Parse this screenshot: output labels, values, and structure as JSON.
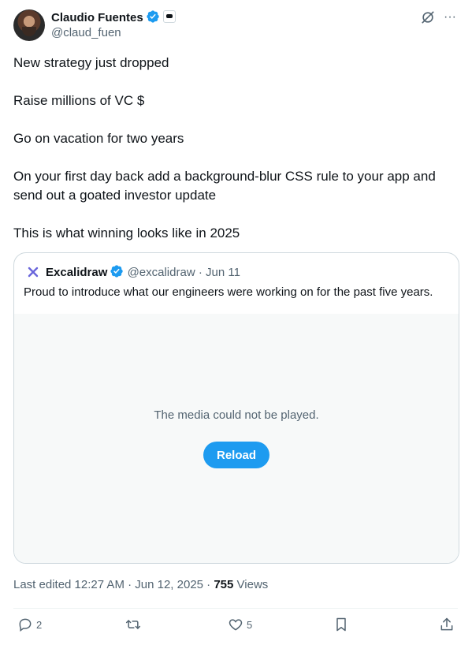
{
  "author": {
    "name": "Claudio Fuentes",
    "handle": "@claud_fuen"
  },
  "top_icons": [
    "grok-icon",
    "more-icon"
  ],
  "more_glyph": "···",
  "post": {
    "paragraphs": [
      "New strategy just dropped",
      "Raise millions of VC $",
      "Go on vacation for two years",
      "On your first day back add a background-blur CSS rule to your app and send out a goated investor update",
      "This is what winning looks like in 2025"
    ]
  },
  "quote": {
    "name": "Excalidraw",
    "handle": "@excalidraw",
    "separator": "·",
    "date": "Jun 11",
    "text": "Proud to introduce what our engineers were working on for the past five years.",
    "media_message": "The media could not be played.",
    "reload_label": "Reload"
  },
  "meta": {
    "edited": "Last edited 12:27 AM · Jun 12, 2025 · ",
    "views_count": "755",
    "views_label": " Views"
  },
  "actions": {
    "replies": "2",
    "likes": "5"
  },
  "colors": {
    "accent": "#1d9bf0",
    "text": "#0f1419",
    "secondary": "#536471",
    "border": "#cfd9de"
  }
}
